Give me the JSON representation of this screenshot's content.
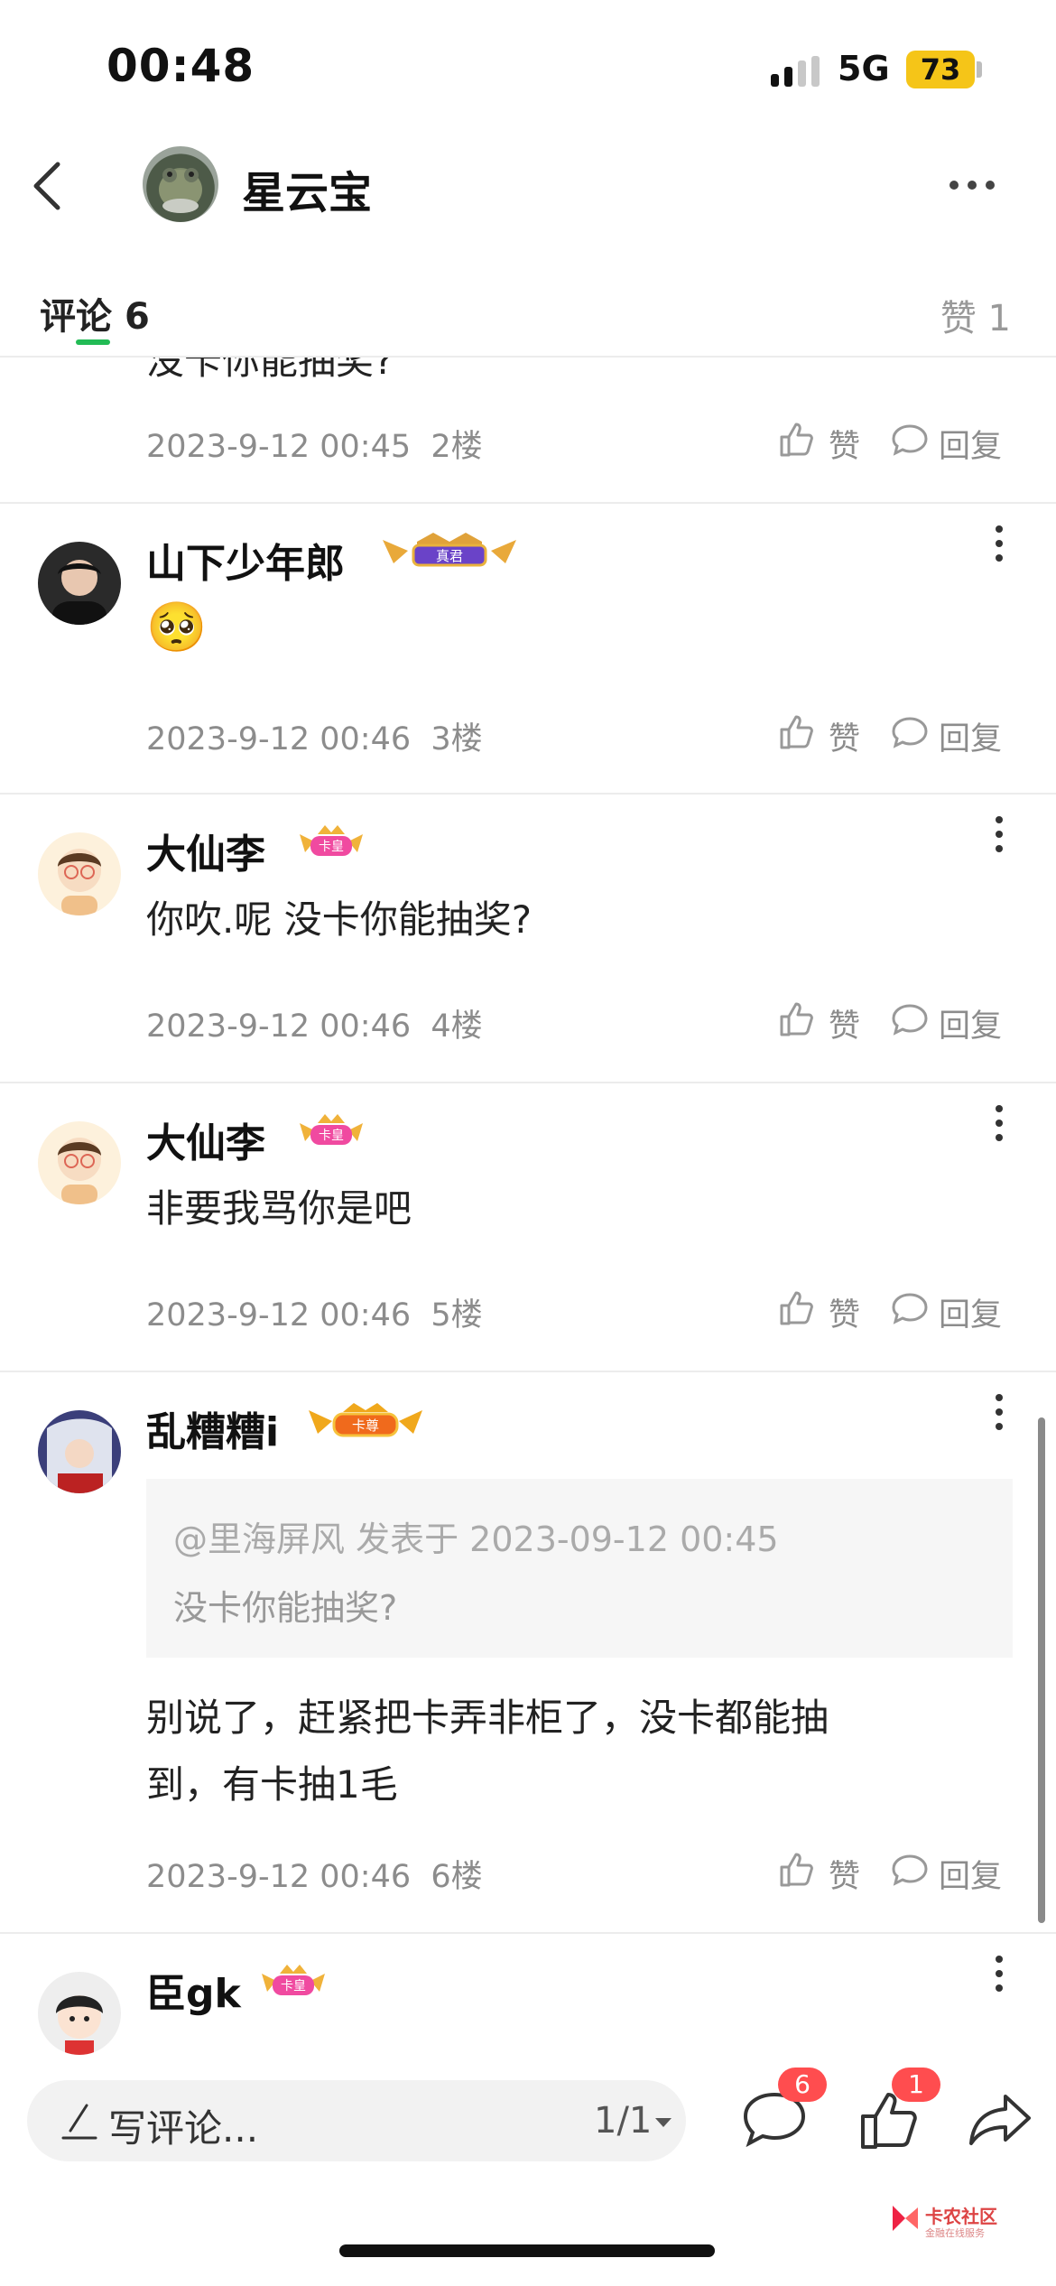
{
  "status_bar": {
    "time": "00:48",
    "network": "5G",
    "battery": "73"
  },
  "header": {
    "title": "星云宝"
  },
  "tabs": {
    "comments_label": "评论",
    "comments_count": "6",
    "likes_label": "赞",
    "likes_count": "1"
  },
  "top_cut_text": "没卡你能抽奖?",
  "comments": [
    {
      "date": "2023-9-12 00:45",
      "floor": "2楼",
      "like": "赞",
      "reply": "回复"
    },
    {
      "author": "山下少年郎",
      "badge": "真君",
      "body": "🥺",
      "date": "2023-9-12 00:46",
      "floor": "3楼",
      "like": "赞",
      "reply": "回复"
    },
    {
      "author": "大仙李",
      "badge": "卡皇",
      "body": "你吹.呢 没卡你能抽奖?",
      "date": "2023-9-12 00:46",
      "floor": "4楼",
      "like": "赞",
      "reply": "回复"
    },
    {
      "author": "大仙李",
      "badge": "卡皇",
      "body": "非要我骂你是吧",
      "date": "2023-9-12 00:46",
      "floor": "5楼",
      "like": "赞",
      "reply": "回复"
    },
    {
      "author": "乱糟糟i",
      "badge": "卡尊",
      "quote_head": "@里海屏风 发表于 2023-09-12 00:45",
      "quote_text": "没卡你能抽奖?",
      "body_line1": "别说了，赶紧把卡弄非柜了，没卡都能抽",
      "body_line2": "到，有卡抽1毛",
      "date": "2023-9-12 00:46",
      "floor": "6楼",
      "like": "赞",
      "reply": "回复"
    },
    {
      "author": "臣gk",
      "badge": "卡皇"
    }
  ],
  "bottom_bar": {
    "compose_placeholder": "写评论...",
    "page_indicator": "1/1",
    "comment_count": "6",
    "like_count": "1",
    "watermark_title": "卡农社区",
    "watermark_sub": "金融在线服务"
  },
  "colors": {
    "accent": "#22bb55",
    "badge_red": "#ff4d4f",
    "battery": "#f5c518"
  }
}
